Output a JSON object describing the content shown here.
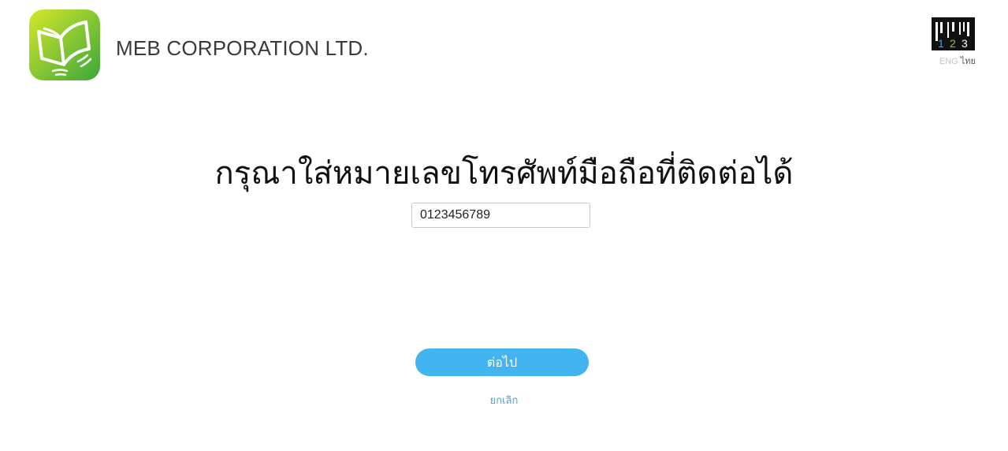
{
  "header": {
    "logo_icon": "open-book-icon",
    "company_name": "MEB CORPORATION LTD.",
    "brand_mark_icon": "barcode-123-icon",
    "language": {
      "eng_label": "ENG",
      "thai_label": "ไทย",
      "selected": "ไทย"
    }
  },
  "form": {
    "title": "กรุณาใส่หมายเลขโทรศัพท์มือถือที่ติดต่อได้",
    "phone_value": "0123456789",
    "next_label": "ต่อไป",
    "cancel_label": "ยกเลิก"
  },
  "colors": {
    "accent": "#42b4f0",
    "link": "#42a8dc",
    "logo_green": "#8cc63f"
  }
}
